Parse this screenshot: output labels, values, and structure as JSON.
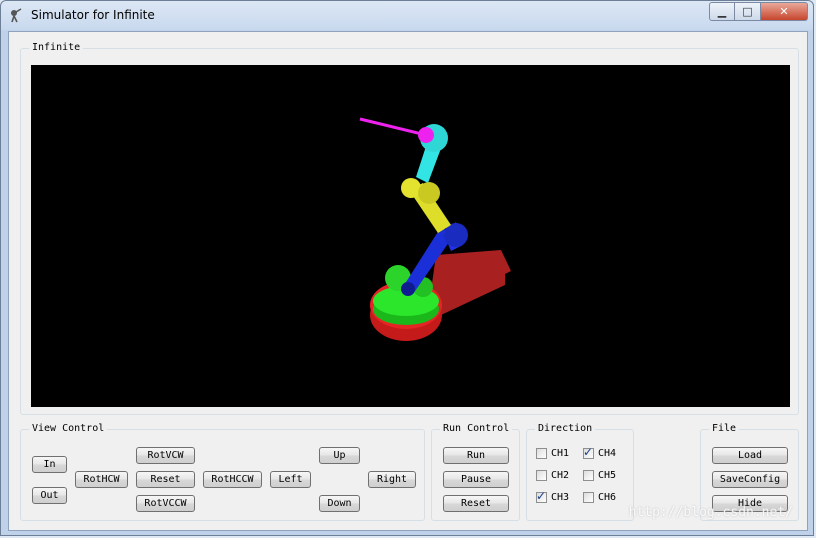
{
  "window": {
    "title": "Simulator for Infinite"
  },
  "caption": {
    "minimize": "▁",
    "maximize": "□",
    "close": "✕"
  },
  "viewport_group": {
    "label": "Infinite"
  },
  "view_control": {
    "label": "View Control",
    "in": "In",
    "out": "Out",
    "rot_hcw": "RotHCW",
    "rot_vcw": "RotVCW",
    "reset": "Reset",
    "rot_vccw": "RotVCCW",
    "rot_hccw": "RotHCCW",
    "left": "Left",
    "up": "Up",
    "down": "Down",
    "right": "Right"
  },
  "run_control": {
    "label": "Run Control",
    "run": "Run",
    "pause": "Pause",
    "reset": "Reset"
  },
  "direction": {
    "label": "Direction",
    "channels": [
      {
        "name": "CH1",
        "checked": false
      },
      {
        "name": "CH2",
        "checked": false
      },
      {
        "name": "CH3",
        "checked": true
      },
      {
        "name": "CH4",
        "checked": true
      },
      {
        "name": "CH5",
        "checked": false
      },
      {
        "name": "CH6",
        "checked": false
      }
    ]
  },
  "file": {
    "label": "File",
    "load": "Load",
    "save_config": "SaveConfig",
    "hide": "Hide"
  },
  "watermark": "http://blog.csdn.net/",
  "colors": {
    "base": "#d42020",
    "base_plate": "#a32222",
    "joint1": "#22dd22",
    "arm_blue": "#1b2fd8",
    "arm_yellow": "#dede2a",
    "arm_cyan": "#33e4e4",
    "tool": "#ee22ee"
  }
}
